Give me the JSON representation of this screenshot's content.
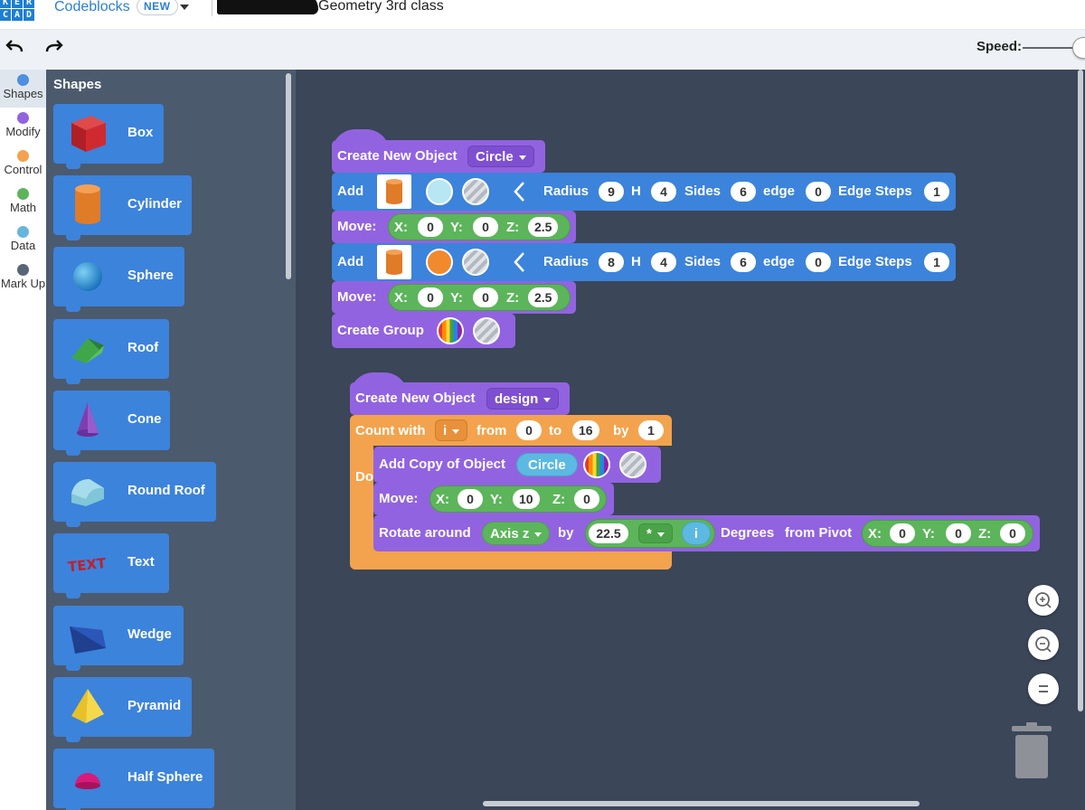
{
  "header": {
    "logo_letters": [
      "K",
      "E",
      "R",
      "C",
      "A",
      "D"
    ],
    "app_name": "Codeblocks",
    "badge": "NEW",
    "project_title": "Geometry 3rd class"
  },
  "toolbar": {
    "undo_icon": "undo-arrow-icon",
    "redo_icon": "redo-arrow-icon",
    "speed_label": "Speed:"
  },
  "categories": [
    {
      "label": "Shapes",
      "color": "#4f8fe0",
      "selected": true
    },
    {
      "label": "Modify",
      "color": "#9263e0"
    },
    {
      "label": "Control",
      "color": "#f3a34d"
    },
    {
      "label": "Math",
      "color": "#5cb55a"
    },
    {
      "label": "Data",
      "color": "#66b6dc"
    },
    {
      "label": "Mark Up",
      "color": "#5a6677"
    }
  ],
  "flyout": {
    "title": "Shapes",
    "items": [
      {
        "label": "Box",
        "icon": "box-icon"
      },
      {
        "label": "Cylinder",
        "icon": "cylinder-icon"
      },
      {
        "label": "Sphere",
        "icon": "sphere-icon"
      },
      {
        "label": "Roof",
        "icon": "roof-icon"
      },
      {
        "label": "Cone",
        "icon": "cone-icon"
      },
      {
        "label": "Round Roof",
        "icon": "round-roof-icon"
      },
      {
        "label": "Text",
        "icon": "text-shape-icon"
      },
      {
        "label": "Wedge",
        "icon": "wedge-icon"
      },
      {
        "label": "Pyramid",
        "icon": "pyramid-icon"
      },
      {
        "label": "Half Sphere",
        "icon": "half-sphere-icon"
      }
    ]
  },
  "program1": {
    "create_label": "Create New Object",
    "object_name": "Circle",
    "add_label": "Add",
    "radius_label": "Radius",
    "h_label": "H",
    "sides_label": "Sides",
    "edge_label": "edge",
    "edge_steps_label": "Edge Steps",
    "add1": {
      "radius": "9",
      "h": "4",
      "sides": "6",
      "edge": "0",
      "edge_steps": "1",
      "color": "#b8e6f2"
    },
    "add2": {
      "radius": "8",
      "h": "4",
      "sides": "6",
      "edge": "0",
      "edge_steps": "1",
      "color": "#f08a2c"
    },
    "move_label": "Move:",
    "x_label": "X:",
    "y_label": "Y:",
    "z_label": "Z:",
    "move1": {
      "x": "0",
      "y": "0",
      "z": "2.5"
    },
    "move2": {
      "x": "0",
      "y": "0",
      "z": "2.5"
    },
    "group_label": "Create Group"
  },
  "program2": {
    "create_label": "Create New Object",
    "object_name": "design",
    "count_label": "Count with",
    "var": "i",
    "from_label": "from",
    "from": "0",
    "to_label": "to",
    "to": "16",
    "by_label": "by",
    "by": "1",
    "do_label": "Do",
    "copy_label": "Add Copy of Object",
    "copy_object": "Circle",
    "move_label": "Move:",
    "x_label": "X:",
    "y_label": "Y:",
    "z_label": "Z:",
    "move": {
      "x": "0",
      "y": "10",
      "z": "0"
    },
    "rotate_label": "Rotate around",
    "axis": "Axis z",
    "rot_by_label": "by",
    "angle": "22.5",
    "operator": "*",
    "multiplier_var": "i",
    "degrees_label": "Degrees",
    "pivot_label": "from Pivot",
    "pivot": {
      "x": "0",
      "y": "0",
      "z": "0"
    }
  },
  "zoom_controls": [
    "zoom-in-icon",
    "zoom-out-icon",
    "zoom-reset-icon"
  ],
  "trash_icon": "trash-icon"
}
